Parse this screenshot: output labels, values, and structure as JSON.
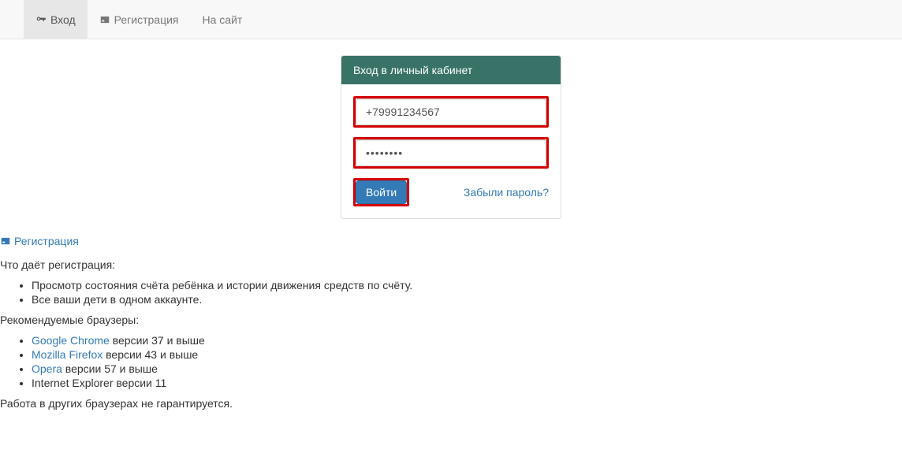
{
  "nav": {
    "login": "Вход",
    "register": "Регистрация",
    "site": "На сайт"
  },
  "panel": {
    "title": "Вход в личный кабинет",
    "phone_value": "+79991234567",
    "password_value": "••••••••",
    "login_btn": "Войти",
    "forgot": "Забыли пароль?"
  },
  "below": {
    "register_link": "Регистрация",
    "what_gives": "Что даёт регистрация:",
    "benefits": [
      "Просмотр состояния счёта ребёнка и истории движения средств по счёту.",
      "Все ваши дети в одном аккаунте."
    ],
    "recommended": "Рекомендуемые браузеры:",
    "browsers": [
      {
        "link": "Google Chrome",
        "rest": " версии 37 и выше"
      },
      {
        "link": "Mozilla Firefox",
        "rest": " версии 43 и выше"
      },
      {
        "link": "Opera",
        "rest": " версии 57 и выше"
      },
      {
        "link": "",
        "rest": "Internet Explorer версии 11"
      }
    ],
    "disclaimer": "Работа в других браузерах не гарантируется."
  }
}
